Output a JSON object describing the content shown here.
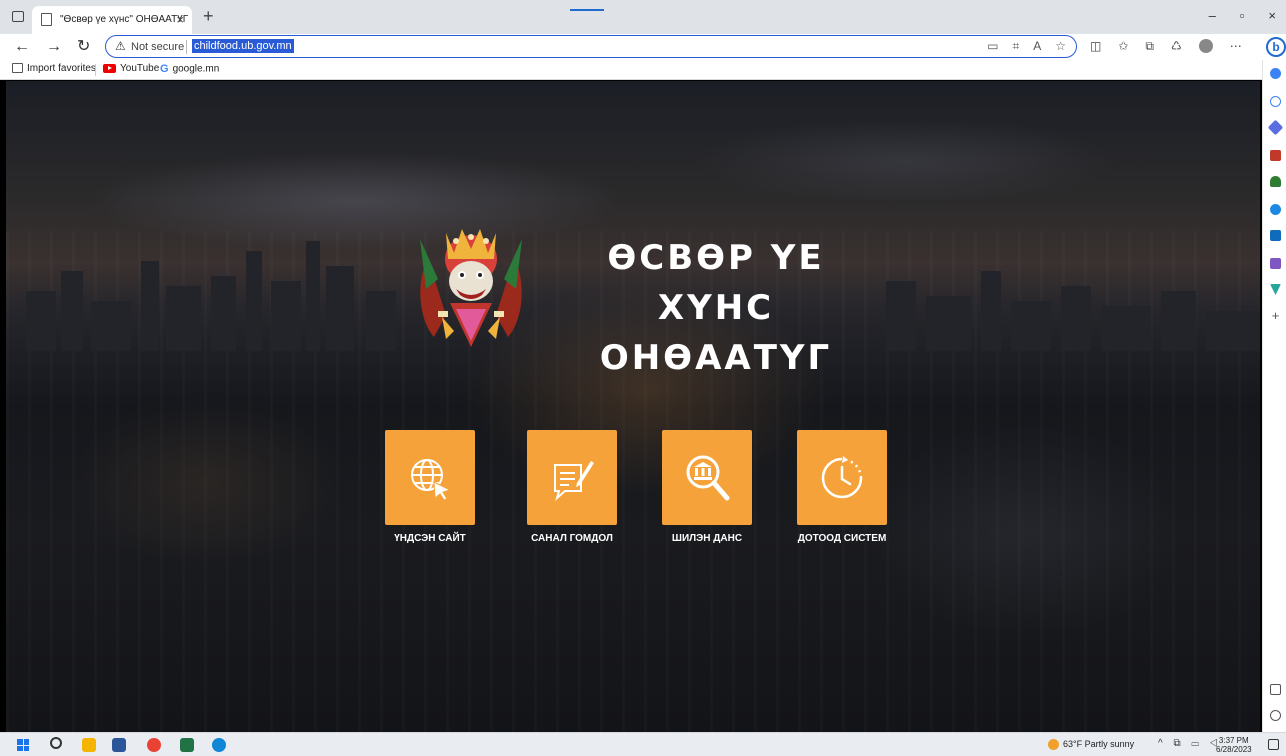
{
  "browser": {
    "tab_title": "\"Өсвөр үе хүнс\" ОНӨААТҮГ",
    "tab_close": "×",
    "new_tab": "+",
    "not_secure_label": "Not secure",
    "url": "childfood.ub.gov.mn",
    "window_controls": {
      "minimize": "–",
      "maximize": "▫",
      "close": "×"
    }
  },
  "favorites": [
    {
      "label": "Import favorites",
      "icon": "folder-icon"
    },
    {
      "label": "YouTube",
      "icon": "youtube-icon"
    },
    {
      "label": "google.mn",
      "icon": "google-icon",
      "glyph": "G"
    }
  ],
  "page": {
    "title_line1": "ӨСВӨР ҮЕ ХҮНС",
    "title_line2": "ОНӨААТҮГ",
    "tiles": [
      {
        "label": "ҮНДСЭН САЙТ",
        "icon": "globe-cursor-icon"
      },
      {
        "label": "САНАЛ ГОМДОЛ",
        "icon": "feedback-form-icon"
      },
      {
        "label": "ШИЛЭН ДАНС",
        "icon": "bank-search-icon"
      },
      {
        "label": "ДОТООД СИСТЕМ",
        "icon": "clock-icon"
      }
    ],
    "accent_color": "#f6a23a"
  },
  "taskbar": {
    "weather": "63°F  Partly sunny",
    "time": "3:37 PM",
    "date": "6/28/2023"
  }
}
